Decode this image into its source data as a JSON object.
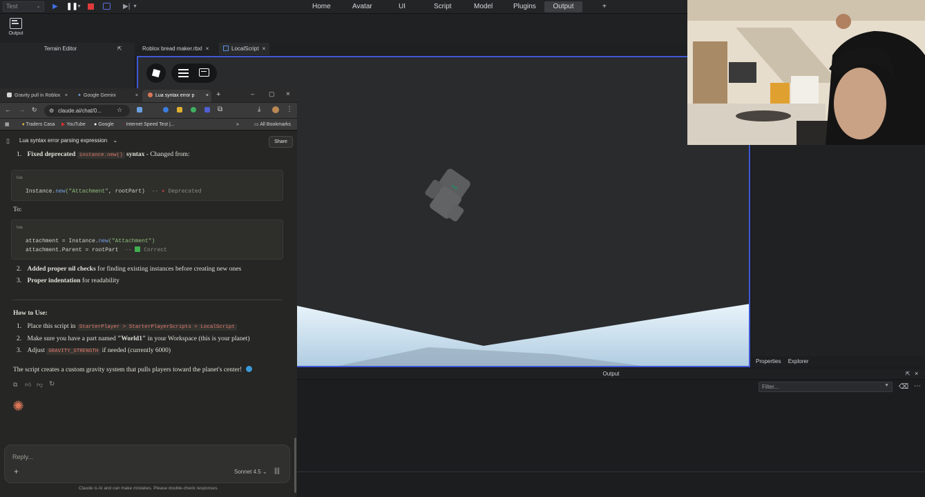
{
  "studio": {
    "run_mode": "Test",
    "menu_tabs": [
      "Home",
      "Avatar",
      "UI",
      "Script",
      "Model",
      "Plugins",
      "Output",
      "+"
    ],
    "active_tab": "Output",
    "ribbon_output_label": "Output",
    "terrain_editor_title": "Terrain Editor",
    "doc_tabs": [
      {
        "label": "Roblox bread maker.rbxl",
        "close": "×"
      },
      {
        "label": "LocalScript",
        "close": "×"
      }
    ],
    "properties_tab": "Properties",
    "explorer_tab": "Explorer",
    "output_panel_title": "Output",
    "filter_placeholder": "Filter..."
  },
  "browser": {
    "tabs": [
      {
        "label": "Gravity pull in Roblox"
      },
      {
        "label": "Google Gemini"
      },
      {
        "label": "Lua syntax error p"
      }
    ],
    "url": "claude.ai/chat/0...",
    "bookmarks": [
      "Traders Casa",
      "YouTube",
      "Google",
      "Internet Speed Test |...",
      "All Bookmarks"
    ]
  },
  "claude": {
    "conversation_title": "Lua syntax error parsing expression",
    "share_label": "Share",
    "item1_prefix": "1.",
    "item1_bold": "Fixed deprecated",
    "item1_code": "instance.new()",
    "item1_rest_bold": "syntax",
    "item1_tail": " - Changed from:",
    "code1_lang": "lua",
    "code1_line_a": "Instance.",
    "code1_line_fn": "new",
    "code1_line_str": "(\"Attachment\"",
    "code1_line_b": ", rootPart)",
    "code1_comment": "-- ",
    "code1_status": "Deprecated",
    "to_label": "To:",
    "code2_lang": "lua",
    "code2_l1_a": "attachment = Instance.",
    "code2_l1_fn": "new",
    "code2_l1_str": "(\"Attachment\")",
    "code2_l2": "attachment.Parent = rootPart",
    "code2_comment": "-- ",
    "code2_status": "Correct",
    "item2_prefix": "2.",
    "item2_bold": "Added proper nil checks",
    "item2_tail": " for finding existing instances before creating new ones",
    "item3_prefix": "3.",
    "item3_bold": "Proper indentation",
    "item3_tail": " for readability",
    "howto_heading": "How to Use:",
    "step1_prefix": "1.",
    "step1_text": "Place this script in",
    "step1_code": "StarterPlayer > StarterPlayerScripts > LocalScript",
    "step2_prefix": "2.",
    "step2_text_a": "Make sure you have a part named ",
    "step2_bold": "\"World1\"",
    "step2_text_b": " in your Workspace (this is your planet)",
    "step3_prefix": "3.",
    "step3_text": "Adjust",
    "step3_code": "GRAVITY_STRENGTH",
    "step3_tail": " if needed (currently 6000)",
    "summary": "The script creates a custom gravity system that pulls players toward the planet's center!",
    "reply_placeholder": "Reply...",
    "model_label": "Sonnet 4.5",
    "footer": "Claude is AI and can make mistakes. Please double-check responses."
  }
}
